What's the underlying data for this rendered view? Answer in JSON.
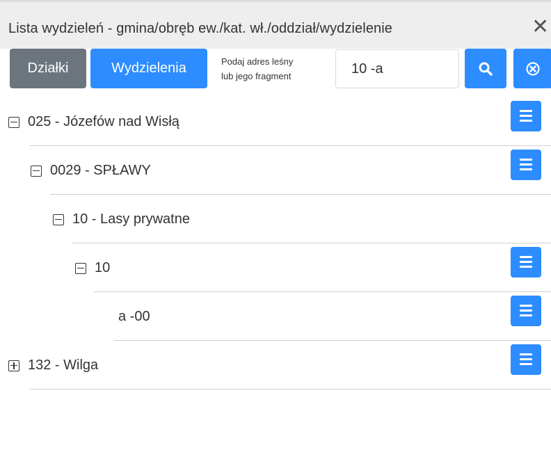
{
  "window": {
    "title": "Lista wydzieleń - gmina/obręb ew./kat. wł./oddział/wydzielenie",
    "close_glyph": "✕"
  },
  "toolbar": {
    "dzialki_label": "Działki",
    "wydzielenia_label": "Wydzielenia",
    "hint_line1": "Podaj adres leśny",
    "hint_line2": "lub jego fragment",
    "search_value": "10 -a",
    "search_icon": "search-icon",
    "clear_icon": "clear-circle-icon"
  },
  "tree": [
    {
      "label": "025 - Józefów nad Wisłą",
      "expanded": true,
      "has_menu": true
    },
    {
      "label": "0029 - SPŁAWY",
      "expanded": true,
      "has_menu": true
    },
    {
      "label": "10 - Lasy prywatne",
      "expanded": true,
      "has_menu": false
    },
    {
      "label": "10",
      "expanded": true,
      "has_menu": true
    },
    {
      "label": "a -00",
      "leaf": true,
      "has_menu": true
    },
    {
      "label": "132 - Wilga",
      "expanded": false,
      "has_menu": true
    }
  ],
  "colors": {
    "primary": "#2d8cff",
    "secondary": "#6c757d",
    "titlebar_bg": "#eeeeee"
  }
}
